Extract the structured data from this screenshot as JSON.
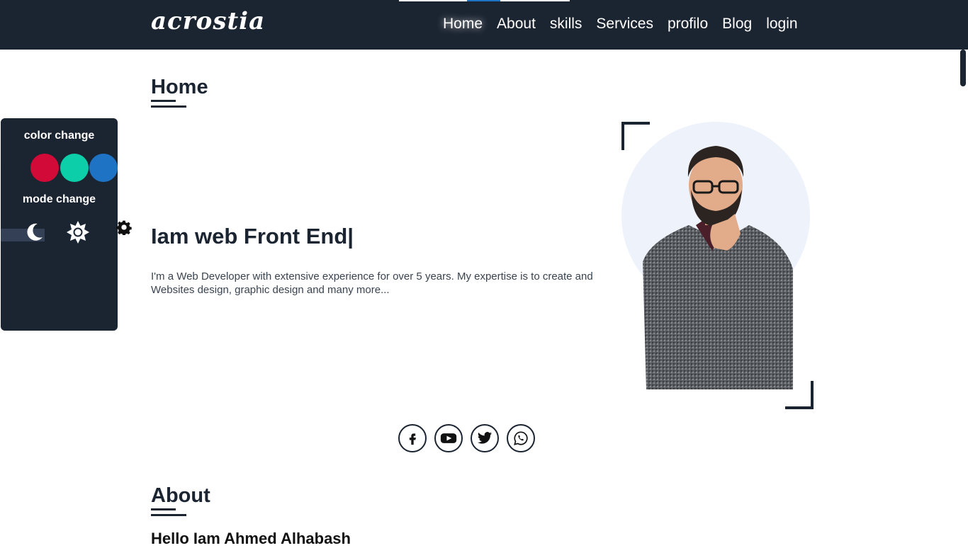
{
  "header": {
    "logo": "acrostia",
    "nav": [
      {
        "label": "Home",
        "active": true
      },
      {
        "label": "About"
      },
      {
        "label": "skills"
      },
      {
        "label": "Services"
      },
      {
        "label": "profilo"
      },
      {
        "label": "Blog"
      },
      {
        "label": "login"
      }
    ]
  },
  "home": {
    "title": "Home",
    "headline": "Iam web Front End|",
    "description": "I'm a Web Developer with extensive experience for over 5 years. My expertise is to create and Websites design, graphic design and many more..."
  },
  "social": [
    "facebook-icon",
    "youtube-icon",
    "twitter-icon",
    "whatsapp-icon"
  ],
  "about": {
    "title": "About",
    "subtitle": "Hello Iam Ahmed Alhabash"
  },
  "settings_panel": {
    "color_label": "color change",
    "mode_label": "mode change",
    "colors": [
      "#1b2431",
      "#d10a37",
      "#0ccfaa",
      "#1f73c4"
    ],
    "modes": [
      "moon-icon",
      "sun-icon"
    ]
  },
  "theme": {
    "primary": "#1b2431",
    "accent": "#1f73c4"
  }
}
